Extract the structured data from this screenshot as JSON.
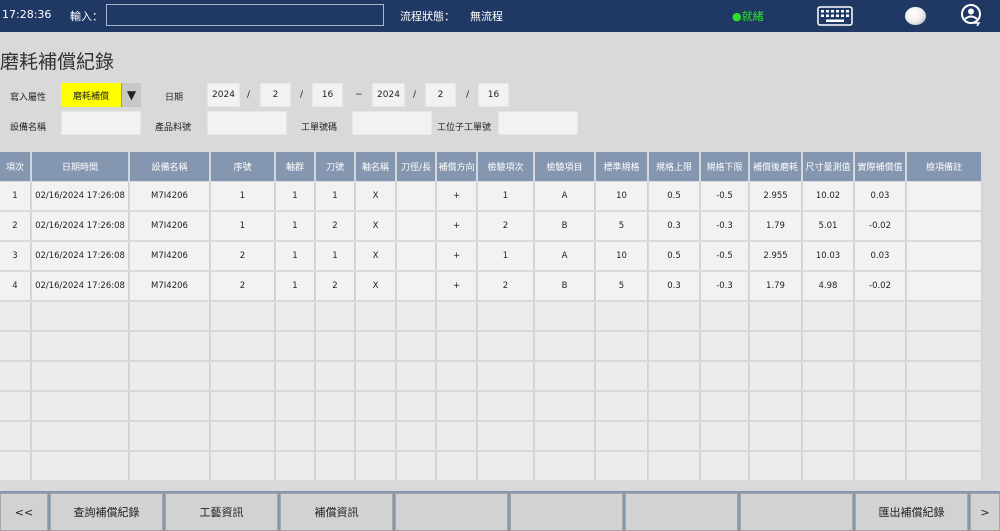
{
  "topbar": {
    "time": "17:28:36",
    "input_label": "輸入：",
    "input_value": "",
    "flow_label": "流程狀態：",
    "flow_value": "無流程",
    "ready_text": "●就緒",
    "icons": [
      "keyboard-icon",
      "status-circle-icon",
      "user-switch-icon"
    ]
  },
  "title": "磨耗補償紀錄",
  "filters": {
    "write_attr_label": "寫入屬性",
    "write_attr_value": "磨耗補償",
    "date_label": "日期",
    "date_from": {
      "year": "2024",
      "month": "2",
      "day": "16"
    },
    "date_to": {
      "year": "2024",
      "month": "2",
      "day": "16"
    },
    "slash": "/",
    "tilde": "~",
    "device_label": "設備名稱",
    "device_value": "",
    "product_label": "產品料號",
    "product_value": "",
    "workorder_label": "工單號碼",
    "workorder_value": "",
    "station_label": "工位子工單號",
    "station_value": ""
  },
  "table": {
    "headers": [
      "項次",
      "日期時間",
      "設備名稱",
      "序號",
      "軸群",
      "刀號",
      "軸名稱",
      "刀徑/長",
      "補償方向",
      "檢驗項次",
      "檢驗項目",
      "標準規格",
      "規格上限",
      "規格下限",
      "補償後磨耗",
      "尺寸量測值",
      "實際補償值",
      "檢項備註"
    ],
    "rows": [
      [
        "1",
        "02/16/2024 17:26:08",
        "M7I4206",
        "1",
        "1",
        "1",
        "X",
        "",
        "+",
        "1",
        "A",
        "10",
        "0.5",
        "-0.5",
        "2.955",
        "10.02",
        "0.03",
        ""
      ],
      [
        "2",
        "02/16/2024 17:26:08",
        "M7I4206",
        "1",
        "1",
        "2",
        "X",
        "",
        "+",
        "2",
        "B",
        "5",
        "0.3",
        "-0.3",
        "1.79",
        "5.01",
        "-0.02",
        ""
      ],
      [
        "3",
        "02/16/2024 17:26:08",
        "M7I4206",
        "2",
        "1",
        "1",
        "X",
        "",
        "+",
        "1",
        "A",
        "10",
        "0.5",
        "-0.5",
        "2.955",
        "10.03",
        "0.03",
        ""
      ],
      [
        "4",
        "02/16/2024 17:26:08",
        "M7I4206",
        "2",
        "1",
        "2",
        "X",
        "",
        "+",
        "2",
        "B",
        "5",
        "0.3",
        "-0.3",
        "1.79",
        "4.98",
        "-0.02",
        ""
      ]
    ],
    "empty_rows": 6
  },
  "bottom": {
    "prev": "<<",
    "query": "查詢補償紀錄",
    "process": "工藝資訊",
    "comp": "補償資訊",
    "export": "匯出補償紀錄",
    "next": ">"
  },
  "colors": {
    "topbar": "#1f3864",
    "header": "#8496b0",
    "highlight": "#ffff00",
    "ready": "#2ee02e"
  }
}
